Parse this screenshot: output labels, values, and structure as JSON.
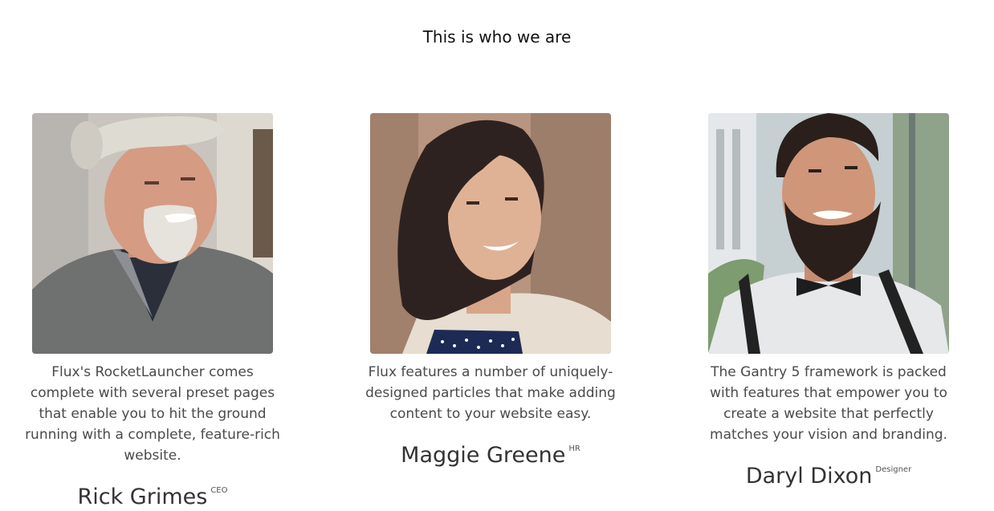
{
  "section": {
    "title": "This is who we are"
  },
  "team": [
    {
      "description": "Flux's RocketLauncher comes complete with several preset pages that enable you to hit the ground running with a complete, feature-rich website.",
      "name": "Rick Grimes",
      "role": "CEO"
    },
    {
      "description": "Flux features a number of uniquely-designed particles that make adding content to your website easy.",
      "name": "Maggie Greene",
      "role": "HR"
    },
    {
      "description": "The Gantry 5 framework is packed with features that empower you to create a website that perfectly matches your vision and branding.",
      "name": "Daryl Dixon",
      "role": "Designer"
    }
  ]
}
